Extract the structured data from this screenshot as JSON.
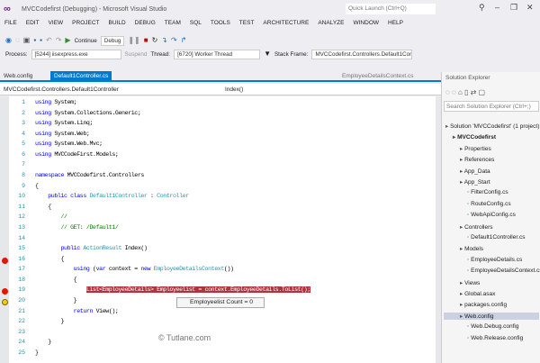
{
  "window": {
    "title": "MVCCodefirst (Debugging) - Microsoft Visual Studio",
    "quick_launch_placeholder": "Quick Launch (Ctrl+Q)"
  },
  "menu": [
    "FILE",
    "EDIT",
    "VIEW",
    "PROJECT",
    "BUILD",
    "DEBUG",
    "TEAM",
    "SQL",
    "TOOLS",
    "TEST",
    "ARCHITECTURE",
    "ANALYZE",
    "WINDOW",
    "HELP"
  ],
  "toolbar": {
    "continue_label": "Continue",
    "config": "Debug"
  },
  "debug_location": {
    "process_label": "Process:",
    "process": "[5244] iisexpress.exe",
    "suspend_label": "Suspend",
    "thread_label": "Thread:",
    "thread": "[6720] Worker Thread",
    "stack_frame_label": "Stack Frame:",
    "stack_frame": "MVCCodefirst.Controllers.Default1Contro"
  },
  "tabs": {
    "left": "Web.config",
    "active": "Default1Controller.cs",
    "right": "EmployeeDetailsContext.cs"
  },
  "navbar": {
    "type": "MVCCodefirst.Controllers.Default1Controller",
    "member": "Index()"
  },
  "code": [
    [
      [
        "using ",
        "kw"
      ],
      [
        "System;",
        "pl"
      ]
    ],
    [
      [
        "using ",
        "kw"
      ],
      [
        "System.Collections.Generic;",
        "pl"
      ]
    ],
    [
      [
        "using ",
        "kw"
      ],
      [
        "System.Linq;",
        "pl"
      ]
    ],
    [
      [
        "using ",
        "kw"
      ],
      [
        "System.Web;",
        "pl"
      ]
    ],
    [
      [
        "using ",
        "kw"
      ],
      [
        "System.Web.Mvc;",
        "pl"
      ]
    ],
    [
      [
        "using ",
        "kw"
      ],
      [
        "MVCCodeFirst.Models;",
        "pl"
      ]
    ],
    [],
    [
      [
        "namespace ",
        "kw"
      ],
      [
        "MVCCodefirst.Controllers",
        "pl"
      ]
    ],
    [
      [
        "{",
        "pl"
      ]
    ],
    [
      [
        "    public class ",
        "kw"
      ],
      [
        "Default1Controller",
        "ty"
      ],
      [
        " : ",
        "pl"
      ],
      [
        "Controller",
        "ty"
      ]
    ],
    [
      [
        "    {",
        "pl"
      ]
    ],
    [
      [
        "        //",
        "cm"
      ]
    ],
    [
      [
        "        // GET: /Default1/",
        "cm"
      ]
    ],
    [],
    [
      [
        "        public ",
        "kw"
      ],
      [
        "ActionResult ",
        "ty"
      ],
      [
        "Index()",
        "pl"
      ]
    ],
    [
      [
        "        {",
        "pl"
      ]
    ],
    [
      [
        "            using ",
        "kw"
      ],
      [
        "(",
        "pl"
      ],
      [
        "var ",
        "kw"
      ],
      [
        "context = ",
        "pl"
      ],
      [
        "new ",
        "kw"
      ],
      [
        "EmployeeDetailsContext",
        "ty"
      ],
      [
        "())",
        "pl"
      ]
    ],
    [
      [
        "            {",
        "pl"
      ]
    ],
    [
      [
        "                ",
        "pl"
      ],
      [
        "List<EmployeeDetails> Employeelist = context.EmployeeDetails.ToList();",
        "hl"
      ]
    ],
    [
      [
        "            }",
        "pl"
      ]
    ],
    [
      [
        "            return ",
        "kw"
      ],
      [
        "View();",
        "pl"
      ]
    ],
    [
      [
        "        }",
        "pl"
      ]
    ],
    [],
    [
      [
        "    }",
        "pl"
      ]
    ],
    [
      [
        "}",
        "pl"
      ]
    ]
  ],
  "breakpoint_lines": [
    16,
    19
  ],
  "current_line": 20,
  "datatip": "Employeelist  Count = 0",
  "watermark": "© Tutlane.com",
  "solution_explorer": {
    "title": "Solution Explorer",
    "search_placeholder": "Search Solution Explorer (Ctrl+;)",
    "items": [
      {
        "label": "Solution 'MVCCodefirst' (1 project)",
        "level": 0
      },
      {
        "label": "MVCCodefirst",
        "level": 1,
        "bold": true
      },
      {
        "label": "Properties",
        "level": 2
      },
      {
        "label": "References",
        "level": 2
      },
      {
        "label": "App_Data",
        "level": 2
      },
      {
        "label": "App_Start",
        "level": 2
      },
      {
        "label": "FilterConfig.cs",
        "level": 3
      },
      {
        "label": "RouteConfig.cs",
        "level": 3
      },
      {
        "label": "WebApiConfig.cs",
        "level": 3
      },
      {
        "label": "Controllers",
        "level": 2
      },
      {
        "label": "Default1Controller.cs",
        "level": 3
      },
      {
        "label": "Models",
        "level": 2
      },
      {
        "label": "EmployeeDetails.cs",
        "level": 3
      },
      {
        "label": "EmployeeDetailsContext.cs",
        "level": 3
      },
      {
        "label": "Views",
        "level": 2
      },
      {
        "label": "Global.asax",
        "level": 2
      },
      {
        "label": "packages.config",
        "level": 2
      },
      {
        "label": "Web.config",
        "level": 2,
        "selected": true
      },
      {
        "label": "Web.Debug.config",
        "level": 3
      },
      {
        "label": "Web.Release.config",
        "level": 3
      }
    ]
  }
}
